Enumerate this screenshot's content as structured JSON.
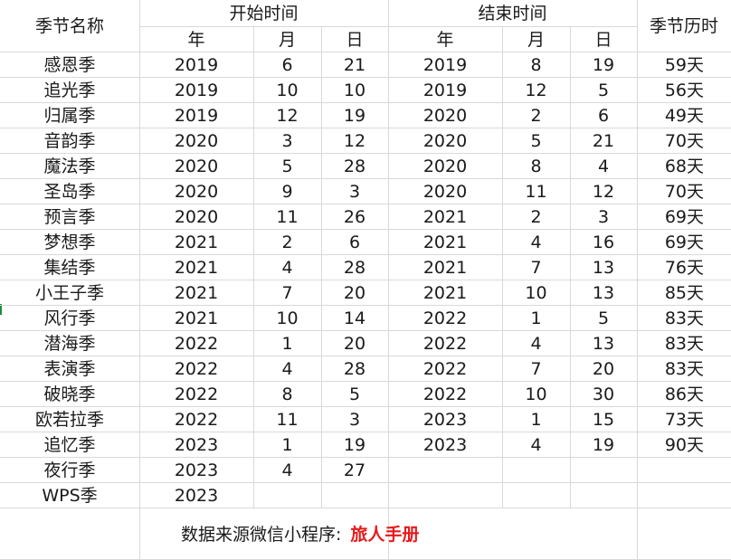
{
  "header": {
    "season_name": "季节名称",
    "start_time": "开始时间",
    "end_time": "结束时间",
    "duration": "季节历时",
    "year": "年",
    "month": "月",
    "day": "日"
  },
  "rows": [
    {
      "name": "感恩季",
      "sy": "2019",
      "sm": "6",
      "sd": "21",
      "ey": "2019",
      "em": "8",
      "ed": "19",
      "days": "59天"
    },
    {
      "name": "追光季",
      "sy": "2019",
      "sm": "10",
      "sd": "10",
      "ey": "2019",
      "em": "12",
      "ed": "5",
      "days": "56天"
    },
    {
      "name": "归属季",
      "sy": "2019",
      "sm": "12",
      "sd": "19",
      "ey": "2020",
      "em": "2",
      "ed": "6",
      "days": "49天"
    },
    {
      "name": "音韵季",
      "sy": "2020",
      "sm": "3",
      "sd": "12",
      "ey": "2020",
      "em": "5",
      "ed": "21",
      "days": "70天"
    },
    {
      "name": "魔法季",
      "sy": "2020",
      "sm": "5",
      "sd": "28",
      "ey": "2020",
      "em": "8",
      "ed": "4",
      "days": "68天"
    },
    {
      "name": "圣岛季",
      "sy": "2020",
      "sm": "9",
      "sd": "3",
      "ey": "2020",
      "em": "11",
      "ed": "12",
      "days": "70天"
    },
    {
      "name": "预言季",
      "sy": "2020",
      "sm": "11",
      "sd": "26",
      "ey": "2021",
      "em": "2",
      "ed": "3",
      "days": "69天"
    },
    {
      "name": "梦想季",
      "sy": "2021",
      "sm": "2",
      "sd": "6",
      "ey": "2021",
      "em": "4",
      "ed": "16",
      "days": "69天"
    },
    {
      "name": "集结季",
      "sy": "2021",
      "sm": "4",
      "sd": "28",
      "ey": "2021",
      "em": "7",
      "ed": "13",
      "days": "76天"
    },
    {
      "name": "小王子季",
      "sy": "2021",
      "sm": "7",
      "sd": "20",
      "ey": "2021",
      "em": "10",
      "ed": "13",
      "days": "85天"
    },
    {
      "name": "风行季",
      "sy": "2021",
      "sm": "10",
      "sd": "14",
      "ey": "2022",
      "em": "1",
      "ed": "5",
      "days": "83天"
    },
    {
      "name": "潜海季",
      "sy": "2022",
      "sm": "1",
      "sd": "20",
      "ey": "2022",
      "em": "4",
      "ed": "13",
      "days": "83天"
    },
    {
      "name": "表演季",
      "sy": "2022",
      "sm": "4",
      "sd": "28",
      "ey": "2022",
      "em": "7",
      "ed": "20",
      "days": "83天"
    },
    {
      "name": "破晓季",
      "sy": "2022",
      "sm": "8",
      "sd": "5",
      "ey": "2022",
      "em": "10",
      "ed": "30",
      "days": "86天"
    },
    {
      "name": "欧若拉季",
      "sy": "2022",
      "sm": "11",
      "sd": "3",
      "ey": "2023",
      "em": "1",
      "ed": "15",
      "days": "73天"
    },
    {
      "name": "追忆季",
      "sy": "2023",
      "sm": "1",
      "sd": "19",
      "ey": "2023",
      "em": "4",
      "ed": "19",
      "days": "90天"
    },
    {
      "name": "夜行季",
      "sy": "2023",
      "sm": "4",
      "sd": "27",
      "ey": "",
      "em": "",
      "ed": "",
      "days": ""
    },
    {
      "name": "WPS季",
      "sy": "2023",
      "sm": "",
      "sd": "",
      "ey": "",
      "em": "",
      "ed": "",
      "days": ""
    }
  ],
  "footer": {
    "source_label": "数据来源微信小程序:",
    "source_name": "旅人手册",
    "source_name_color": "#e8191b"
  }
}
